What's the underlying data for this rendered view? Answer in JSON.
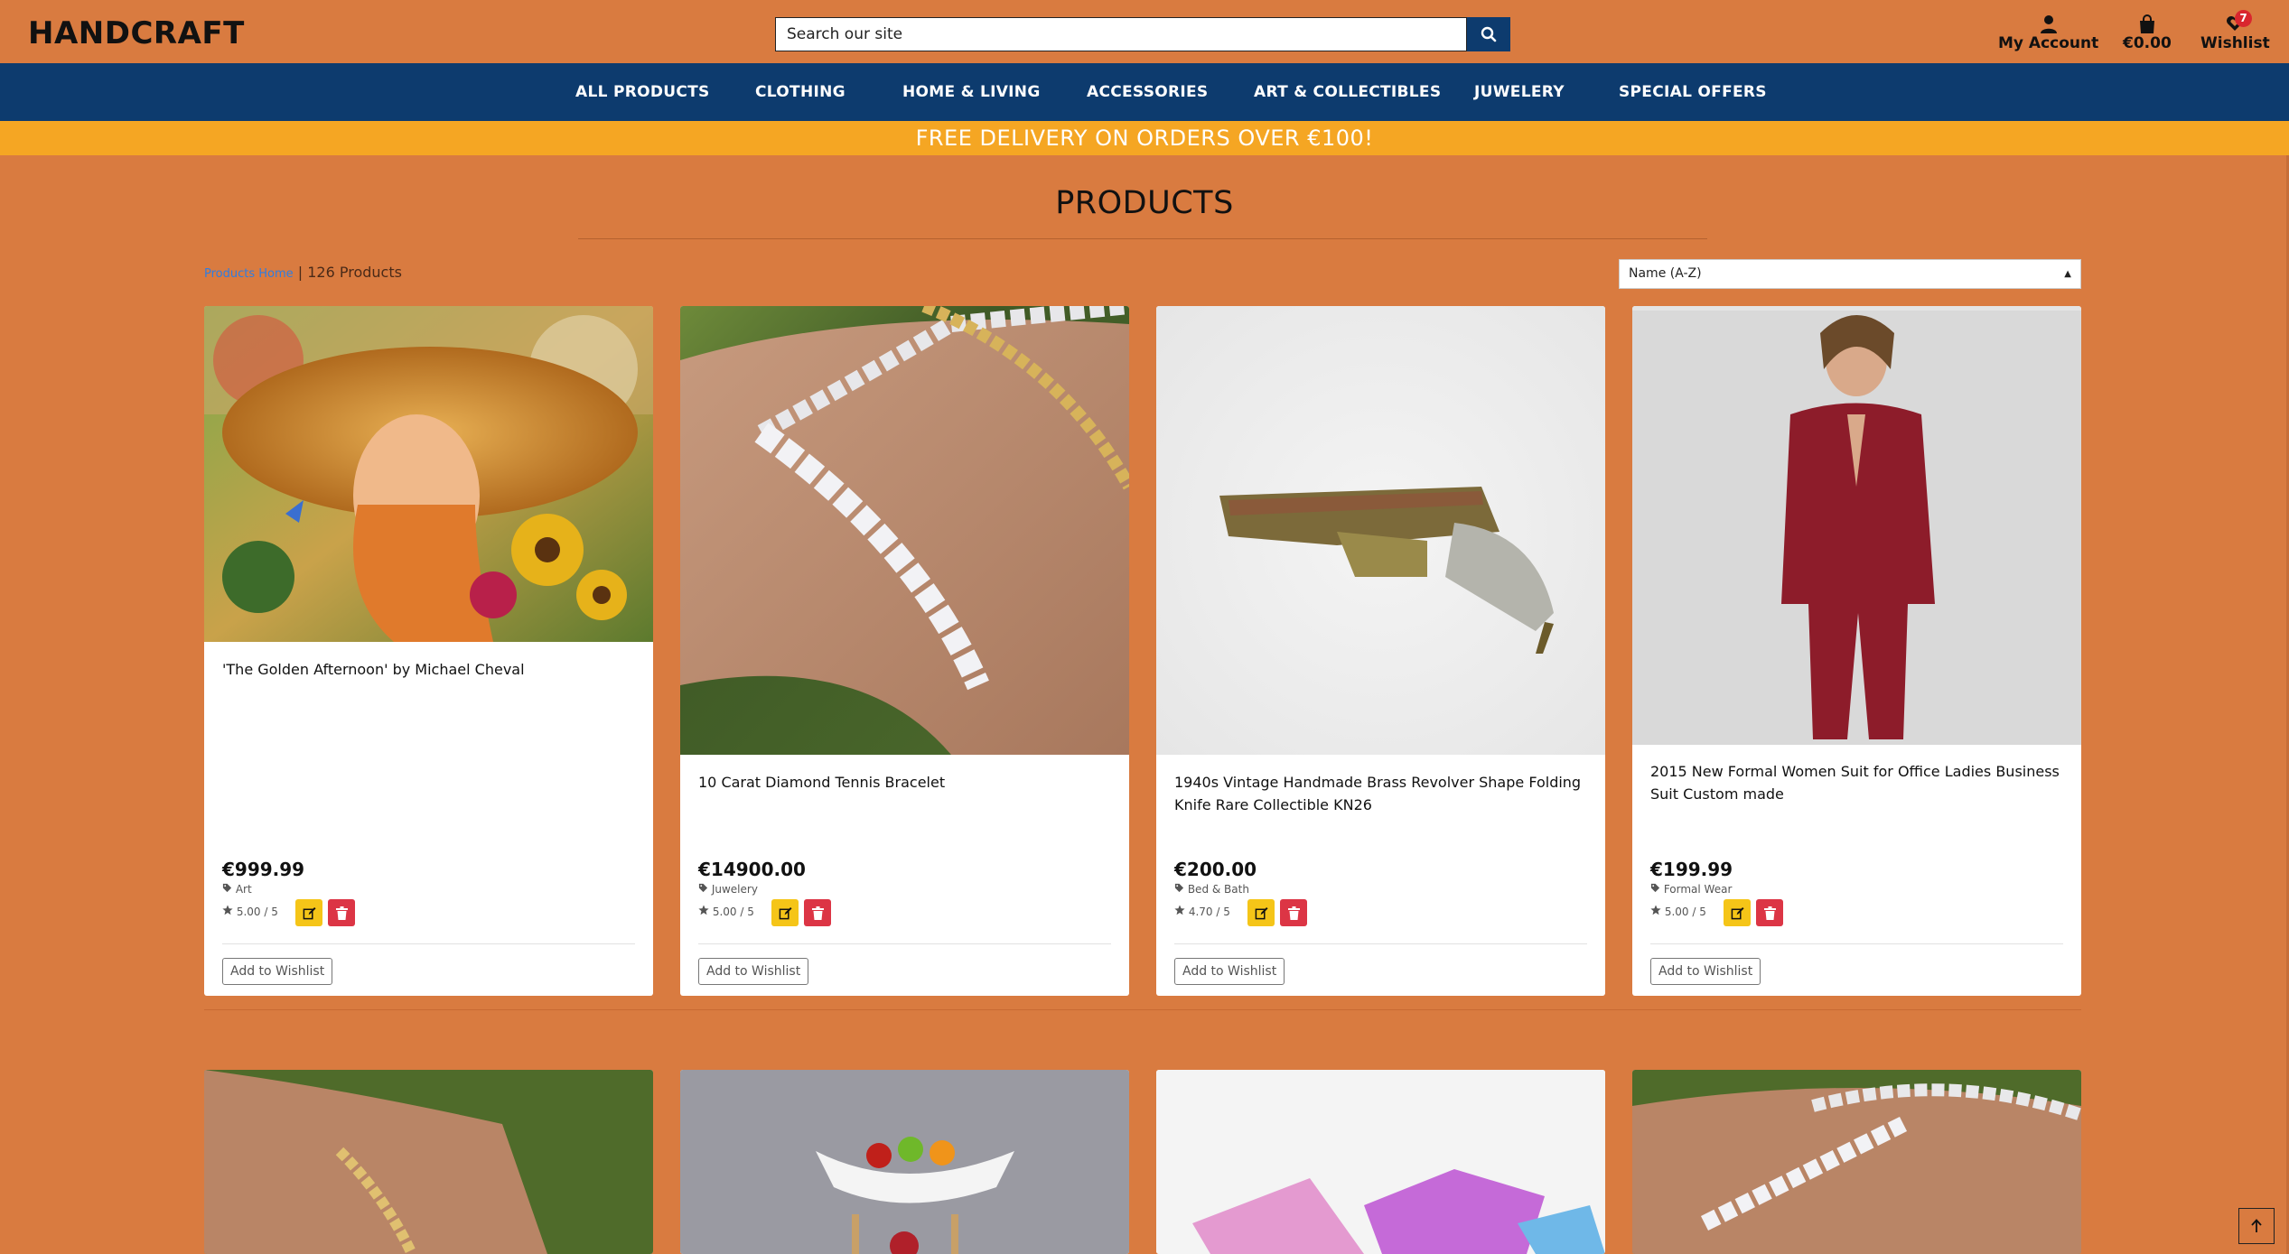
{
  "header": {
    "brand": "HANDCRAFT",
    "search_placeholder": "Search our site",
    "account_label": "My Account",
    "cart_total": "€0.00",
    "wishlist_label": "Wishlist",
    "wishlist_count": "7"
  },
  "nav": {
    "items": [
      "ALL PRODUCTS",
      "CLOTHING",
      "HOME & LIVING",
      "ACCESSORIES",
      "ART & COLLECTIBLES",
      "JUWELERY",
      "SPECIAL OFFERS"
    ]
  },
  "promo": "FREE DELIVERY ON ORDERS OVER €100!",
  "page": {
    "title": "PRODUCTS",
    "breadcrumb_link": "Products Home",
    "breadcrumb_sep": " | ",
    "product_count": "126 Products",
    "sort_selected": "Name (A-Z)"
  },
  "products": [
    {
      "name": "'The Golden Afternoon' by Michael Cheval",
      "price": "€999.99",
      "category": "Art",
      "rating": "5.00 / 5",
      "wishlist_label": "Add to Wishlist"
    },
    {
      "name": "10 Carat Diamond Tennis Bracelet",
      "price": "€14900.00",
      "category": "Juwelery",
      "rating": "5.00 / 5",
      "wishlist_label": "Add to Wishlist"
    },
    {
      "name": "1940s Vintage Handmade Brass Revolver Shape Folding Knife Rare Collectible KN26",
      "price": "€200.00",
      "category": "Bed & Bath",
      "rating": "4.70 / 5",
      "wishlist_label": "Add to Wishlist"
    },
    {
      "name": "2015 New Formal Women Suit for Office Ladies Business Suit Custom made",
      "price": "€199.99",
      "category": "Formal Wear",
      "rating": "5.00 / 5",
      "wishlist_label": "Add to Wishlist"
    }
  ],
  "colors": {
    "page_bg": "#d97b40",
    "nav_bg": "#0d3b6e",
    "promo_bg": "#f5a623",
    "edit_btn": "#f5c518",
    "delete_btn": "#dc3545"
  }
}
